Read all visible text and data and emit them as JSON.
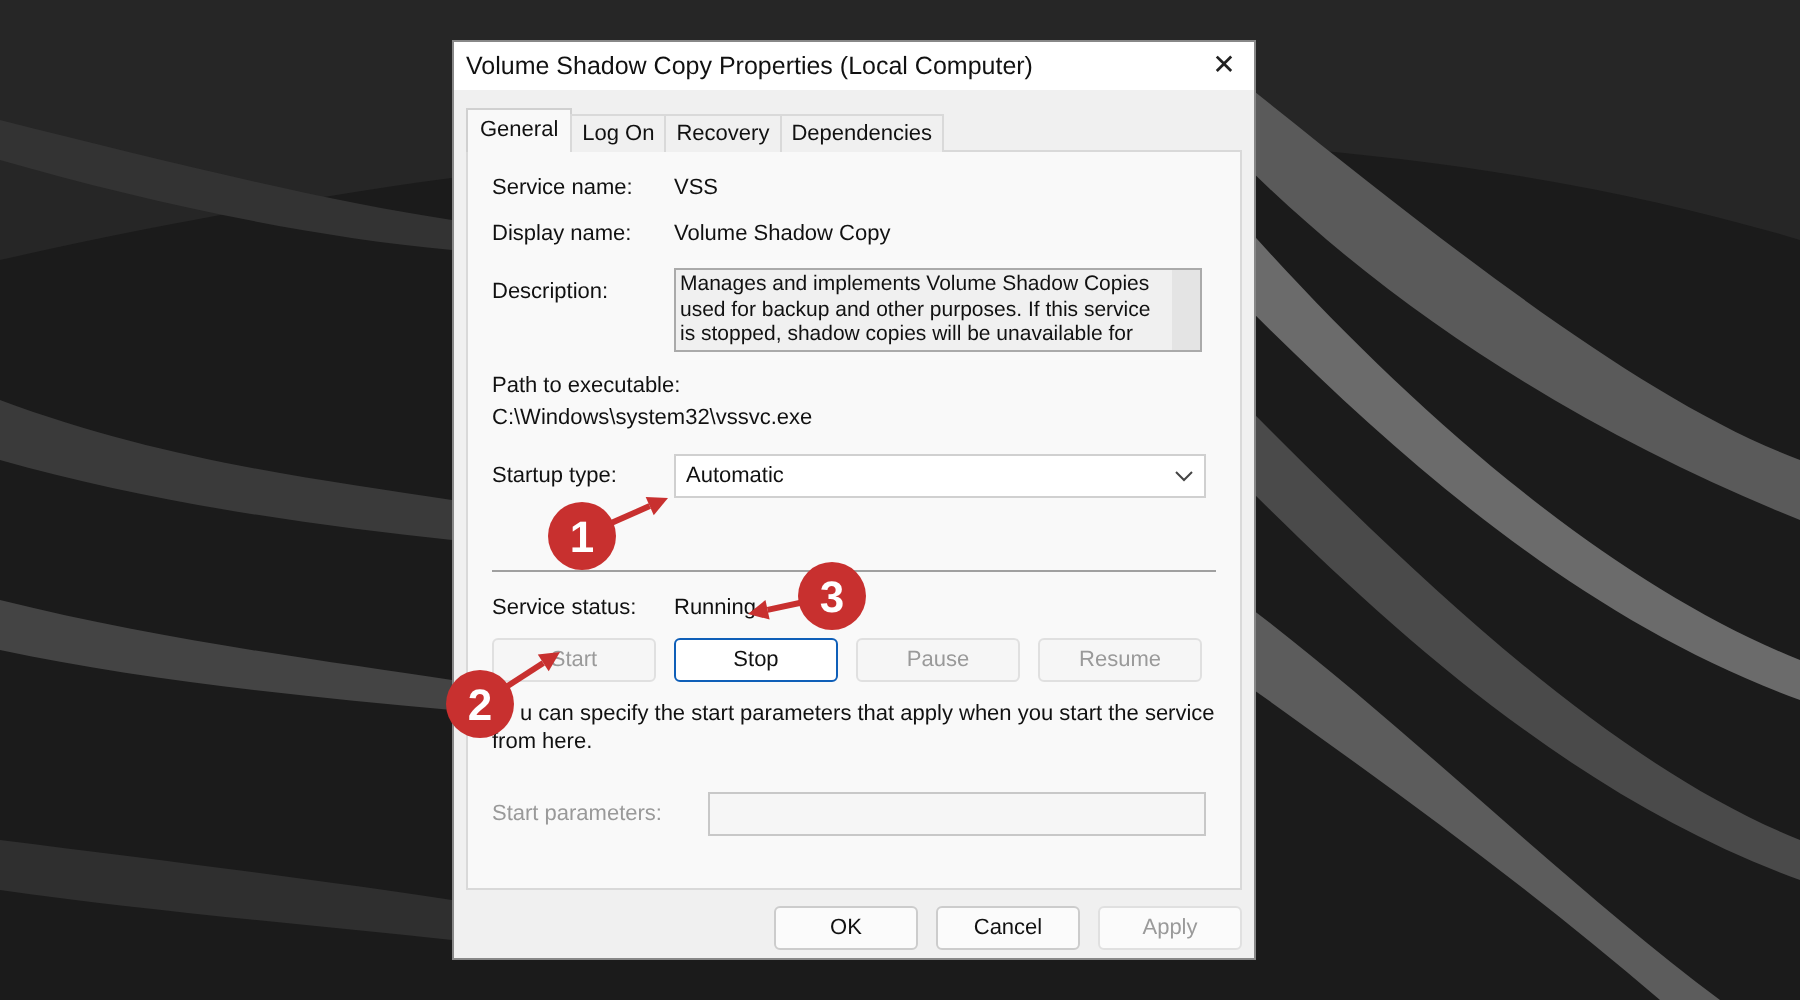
{
  "window": {
    "title": "Volume Shadow Copy Properties (Local Computer)",
    "close": "✕"
  },
  "tabs": [
    {
      "label": "General",
      "selected": true
    },
    {
      "label": "Log On",
      "selected": false
    },
    {
      "label": "Recovery",
      "selected": false
    },
    {
      "label": "Dependencies",
      "selected": false
    }
  ],
  "fields": [
    {
      "label": "Service name:",
      "value": "VSS"
    },
    {
      "label": "Display name:",
      "value": "Volume Shadow Copy"
    }
  ],
  "description": {
    "label": "Description:",
    "text": "Manages and implements Volume Shadow Copies used for backup and other purposes. If this service is stopped, shadow copies will be unavailable for"
  },
  "path": {
    "label": "Path to executable:",
    "value": "C:\\Windows\\system32\\vssvc.exe"
  },
  "startup_type": {
    "label": "Startup type:",
    "value": "Automatic"
  },
  "service_status": {
    "label": "Service status:",
    "value": "Running"
  },
  "service_buttons": [
    {
      "label": "Start",
      "disabled": true
    },
    {
      "label": "Stop",
      "disabled": false
    },
    {
      "label": "Pause",
      "disabled": true
    },
    {
      "label": "Resume",
      "disabled": true
    }
  ],
  "hint": "u can specify the start parameters that apply when you start the service from here.",
  "start_parameters": {
    "label": "Start parameters:",
    "disabled": true
  },
  "dialog_buttons": [
    {
      "label": "OK",
      "disabled": false
    },
    {
      "label": "Cancel",
      "disabled": false
    },
    {
      "label": "Apply",
      "disabled": true
    }
  ],
  "annotations": [
    {
      "label": "1"
    },
    {
      "label": "2"
    },
    {
      "label": "3"
    }
  ]
}
